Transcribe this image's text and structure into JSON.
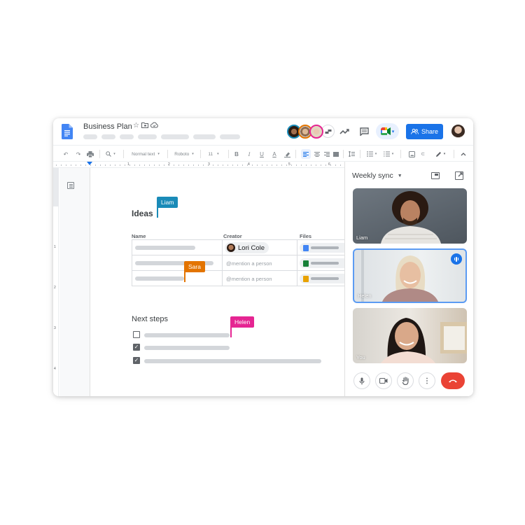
{
  "header": {
    "doc_title": "Business Plan",
    "title_icons": [
      "star-icon",
      "move-to-folder-icon",
      "cloud-saved-icon"
    ],
    "menu_pill_count": 8,
    "collaborators": [
      {
        "name": "Liam",
        "ring_color": "#1a8bb8"
      },
      {
        "name": "Sara",
        "ring_color": "#e37400"
      },
      {
        "name": "Helen",
        "ring_color": "#e52592"
      }
    ],
    "icons": [
      "show-all-icon",
      "activity-trend-icon",
      "comments-icon"
    ],
    "meet_button": {
      "icon": "google-meet-icon",
      "dropdown": "▾"
    },
    "share_label": "Share"
  },
  "toolbar": {
    "undo": "undo-icon",
    "redo": "redo-icon",
    "print": "print-icon",
    "zoom": "zoom-icon",
    "style_select": "Normal text",
    "font_select": "Roboto",
    "size_select": "11",
    "bold": "B",
    "italic": "I",
    "underline": "U",
    "text_color": "A",
    "highlight": "highlighter-icon",
    "align": [
      "align-left-icon",
      "align-center-icon",
      "align-right-icon",
      "justify-icon"
    ],
    "line_spacing": "line-spacing-icon",
    "bulleted": "bulleted-list-icon",
    "numbered": "numbered-list-icon",
    "image": "insert-image-icon",
    "link": "link-icon",
    "editing_mode": "pencil-icon",
    "collapse": "chevron-up-icon"
  },
  "ruler": {
    "h_numbers": [
      "1",
      "2",
      "3",
      "4",
      "5",
      "6"
    ],
    "v_numbers": [
      "1",
      "2",
      "3",
      "4"
    ]
  },
  "document": {
    "ideas_heading": "Ideas",
    "table": {
      "headers": [
        "Name",
        "Creator",
        "Files"
      ],
      "rows": [
        {
          "creator_chip": "Lori Cole",
          "file_type": "docs",
          "file_color": "#4285f4"
        },
        {
          "creator_placeholder": "@mention a person",
          "file_type": "sheets",
          "file_color": "#188038"
        },
        {
          "creator_placeholder": "@mention a person",
          "file_type": "slides",
          "file_color": "#e8a200"
        }
      ]
    },
    "next_steps_heading": "Next steps",
    "checklist": [
      {
        "checked": false
      },
      {
        "checked": true
      },
      {
        "checked": true
      }
    ],
    "cursors": [
      {
        "name": "Liam",
        "color": "#1a8bb8"
      },
      {
        "name": "Sara",
        "color": "#e37400"
      },
      {
        "name": "Helen",
        "color": "#e52592"
      }
    ]
  },
  "meet": {
    "title": "Weekly sync",
    "participants": [
      {
        "name": "Liam",
        "speaking": false
      },
      {
        "name": "Helen",
        "speaking": true
      },
      {
        "name": "You",
        "speaking": false
      }
    ],
    "controls": [
      "microphone-icon",
      "camera-icon",
      "raise-hand-icon",
      "more-options-icon",
      "hang-up-icon"
    ],
    "accent": "#1a73e8",
    "hangup_color": "#ea4335"
  }
}
